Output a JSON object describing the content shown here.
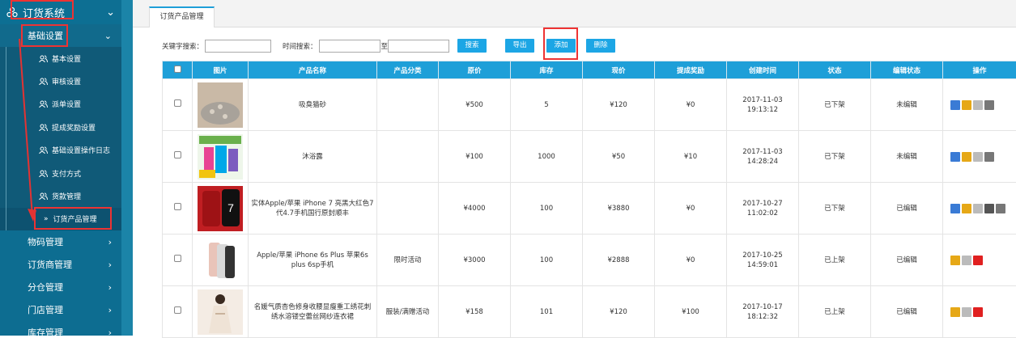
{
  "sidebar": {
    "title": "订货系统",
    "section": "基础设置",
    "items": [
      {
        "label": "基本设置"
      },
      {
        "label": "审核设置"
      },
      {
        "label": "派单设置"
      },
      {
        "label": "提成奖励设置"
      },
      {
        "label": "基础设置操作日志"
      },
      {
        "label": "支付方式"
      },
      {
        "label": "货款管理"
      },
      {
        "label": "订货产品管理"
      }
    ],
    "groups": [
      {
        "label": "物码管理"
      },
      {
        "label": "订货商管理"
      },
      {
        "label": "分仓管理"
      },
      {
        "label": "门店管理"
      },
      {
        "label": "库存管理"
      }
    ]
  },
  "tab": {
    "label": "订货产品管理"
  },
  "search": {
    "keyword_label": "关键字搜索：",
    "time_label": "时间搜索：",
    "to_label": "至",
    "keyword_value": "",
    "time_from": "",
    "time_to": ""
  },
  "buttons": {
    "search": "搜索",
    "export": "导出",
    "add": "添加",
    "delete": "删除"
  },
  "table": {
    "headers": [
      "",
      "图片",
      "产品名称",
      "产品分类",
      "原价",
      "库存",
      "现价",
      "提成奖励",
      "创建时间",
      "状态",
      "编辑状态",
      "操作"
    ],
    "rows": [
      {
        "name": "吸臭猫砂",
        "category": "",
        "price": "¥500",
        "stock": "5",
        "now": "¥120",
        "reward": "¥0",
        "created": "2017-11-03 19:13:12",
        "status": "已下架",
        "edit": "未编辑"
      },
      {
        "name": "沐浴露",
        "category": "",
        "price": "¥100",
        "stock": "1000",
        "now": "¥50",
        "reward": "¥10",
        "created": "2017-11-03 14:28:24",
        "status": "已下架",
        "edit": "未编辑"
      },
      {
        "name": "实体Apple/苹果 iPhone 7 亮黑大红色7代4.7手机国行原封顺丰",
        "category": "",
        "price": "¥4000",
        "stock": "100",
        "now": "¥3880",
        "reward": "¥0",
        "created": "2017-10-27 11:02:02",
        "status": "已下架",
        "edit": "已编辑"
      },
      {
        "name": "Apple/苹果 iPhone 6s Plus 苹果6s plus 6sp手机",
        "category": "限时活动",
        "price": "¥3000",
        "stock": "100",
        "now": "¥2888",
        "reward": "¥0",
        "created": "2017-10-25 14:59:01",
        "status": "已上架",
        "edit": "已编辑"
      },
      {
        "name": "名媛气质杏色修身收腰显瘦重工绣花刺绣水溶镂空蕾丝网纱连衣裙",
        "category": "服装/满赠活动",
        "price": "¥158",
        "stock": "101",
        "now": "¥120",
        "reward": "¥100",
        "created": "2017-10-17 18:12:32",
        "status": "已上架",
        "edit": "已编辑"
      }
    ]
  },
  "colors": {
    "sidebar": "#0d6d91",
    "accent": "#1e9fd8",
    "highlight": "#e33333"
  }
}
